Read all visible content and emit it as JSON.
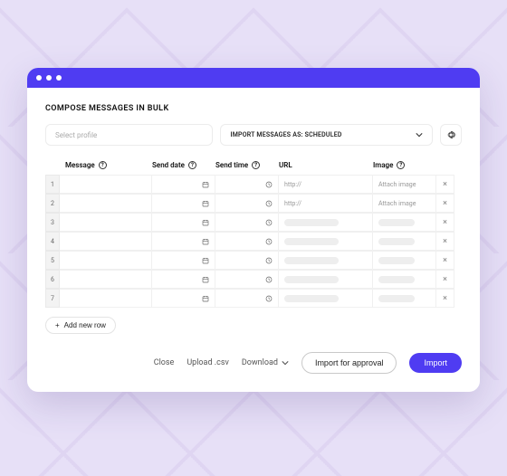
{
  "title": "COMPOSE MESSAGES IN BULK",
  "profile_placeholder": "Select profile",
  "import_mode_label": "IMPORT MESSAGES AS: SCHEDULED",
  "columns": {
    "message": "Message",
    "send_date": "Send date",
    "send_time": "Send time",
    "url": "URL",
    "image": "Image"
  },
  "rows": [
    {
      "n": "1",
      "url": "http://",
      "image": "Attach image"
    },
    {
      "n": "2",
      "url": "http://",
      "image": "Attach image"
    },
    {
      "n": "3"
    },
    {
      "n": "4"
    },
    {
      "n": "5"
    },
    {
      "n": "6"
    },
    {
      "n": "7"
    }
  ],
  "add_row_label": "Add new row",
  "footer": {
    "close": "Close",
    "upload": "Upload .csv",
    "download": "Download",
    "approval": "Import for approval",
    "import": "Import"
  },
  "colors": {
    "accent": "#4f3cf2"
  }
}
